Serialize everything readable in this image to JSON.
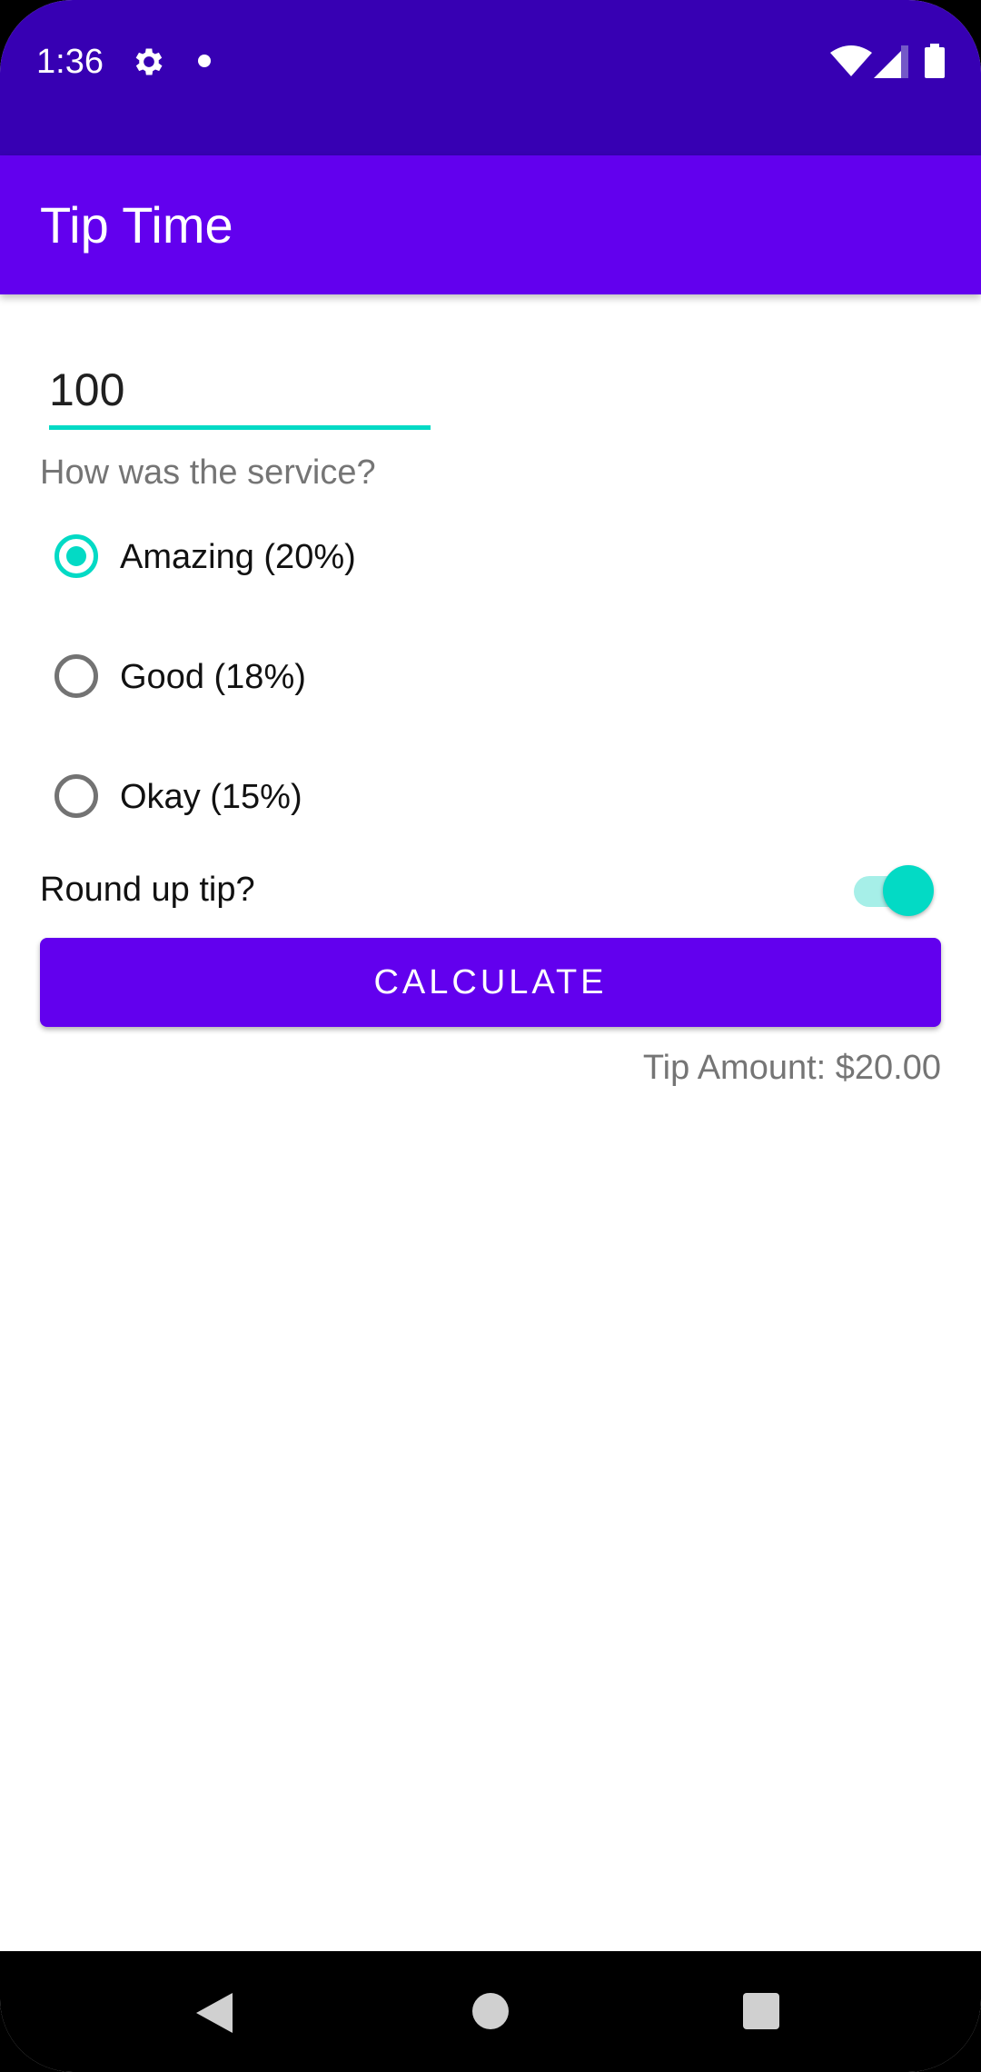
{
  "status_bar": {
    "time": "1:36",
    "icons": [
      "gear-icon",
      "notification-dot-icon",
      "wifi-icon",
      "signal-icon",
      "battery-icon"
    ]
  },
  "app_bar": {
    "title": "Tip Time"
  },
  "cost_of_service": {
    "value": "100"
  },
  "service_question": "How was the service?",
  "tip_options": [
    {
      "label": "Amazing (20%)",
      "checked": true
    },
    {
      "label": "Good (18%)",
      "checked": false
    },
    {
      "label": "Okay (15%)",
      "checked": false
    }
  ],
  "round_up": {
    "label": "Round up tip?",
    "on": true
  },
  "calculate_button": {
    "label": "CALCULATE"
  },
  "tip_result": "Tip Amount: $20.00",
  "colors": {
    "primary": "#6200ee",
    "primary_dark": "#3700b3",
    "accent": "#03dac5"
  },
  "nav_bar": {
    "icons": [
      "back-icon",
      "home-icon",
      "recents-icon"
    ]
  }
}
